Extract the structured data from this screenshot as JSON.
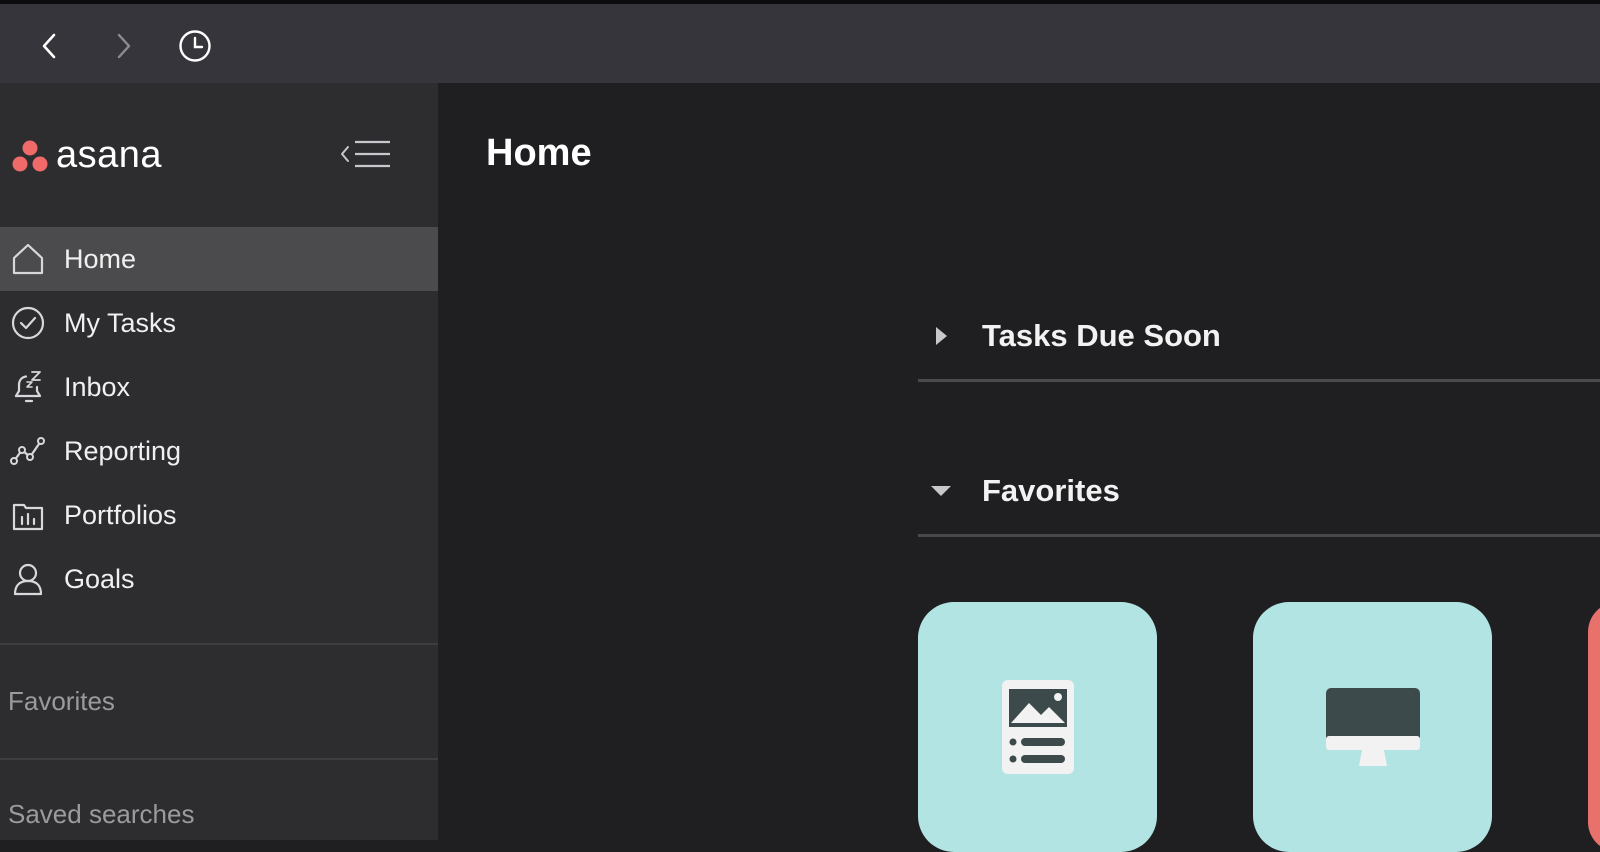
{
  "toolbar": {
    "back_icon": "chevron-left-icon",
    "forward_icon": "chevron-right-icon",
    "history_icon": "clock-icon"
  },
  "sidebar": {
    "logo_text": "asana",
    "items": [
      {
        "label": "Home",
        "icon": "home-icon",
        "active": true
      },
      {
        "label": "My Tasks",
        "icon": "check-circle-icon",
        "active": false
      },
      {
        "label": "Inbox",
        "icon": "bell-snooze-icon",
        "active": false
      },
      {
        "label": "Reporting",
        "icon": "line-graph-icon",
        "active": false
      },
      {
        "label": "Portfolios",
        "icon": "portfolio-icon",
        "active": false
      },
      {
        "label": "Goals",
        "icon": "goal-person-icon",
        "active": false
      }
    ],
    "favorites_label": "Favorites",
    "saved_searches_label": "Saved searches"
  },
  "main": {
    "title": "Home",
    "sections": [
      {
        "title": "Tasks Due Soon",
        "expanded": false
      },
      {
        "title": "Favorites",
        "expanded": true
      }
    ],
    "favorite_tiles": [
      {
        "icon": "document-image-icon",
        "color": "#b2e4e3"
      },
      {
        "icon": "monitor-icon",
        "color": "#b2e4e3"
      },
      {
        "icon": "",
        "color": "#e8716c"
      }
    ]
  },
  "colors": {
    "accent_logo": "#f06a6a",
    "sidebar_bg": "#2d2d30",
    "main_bg": "#1f1f22",
    "active_item_bg": "#4b4b4e"
  }
}
